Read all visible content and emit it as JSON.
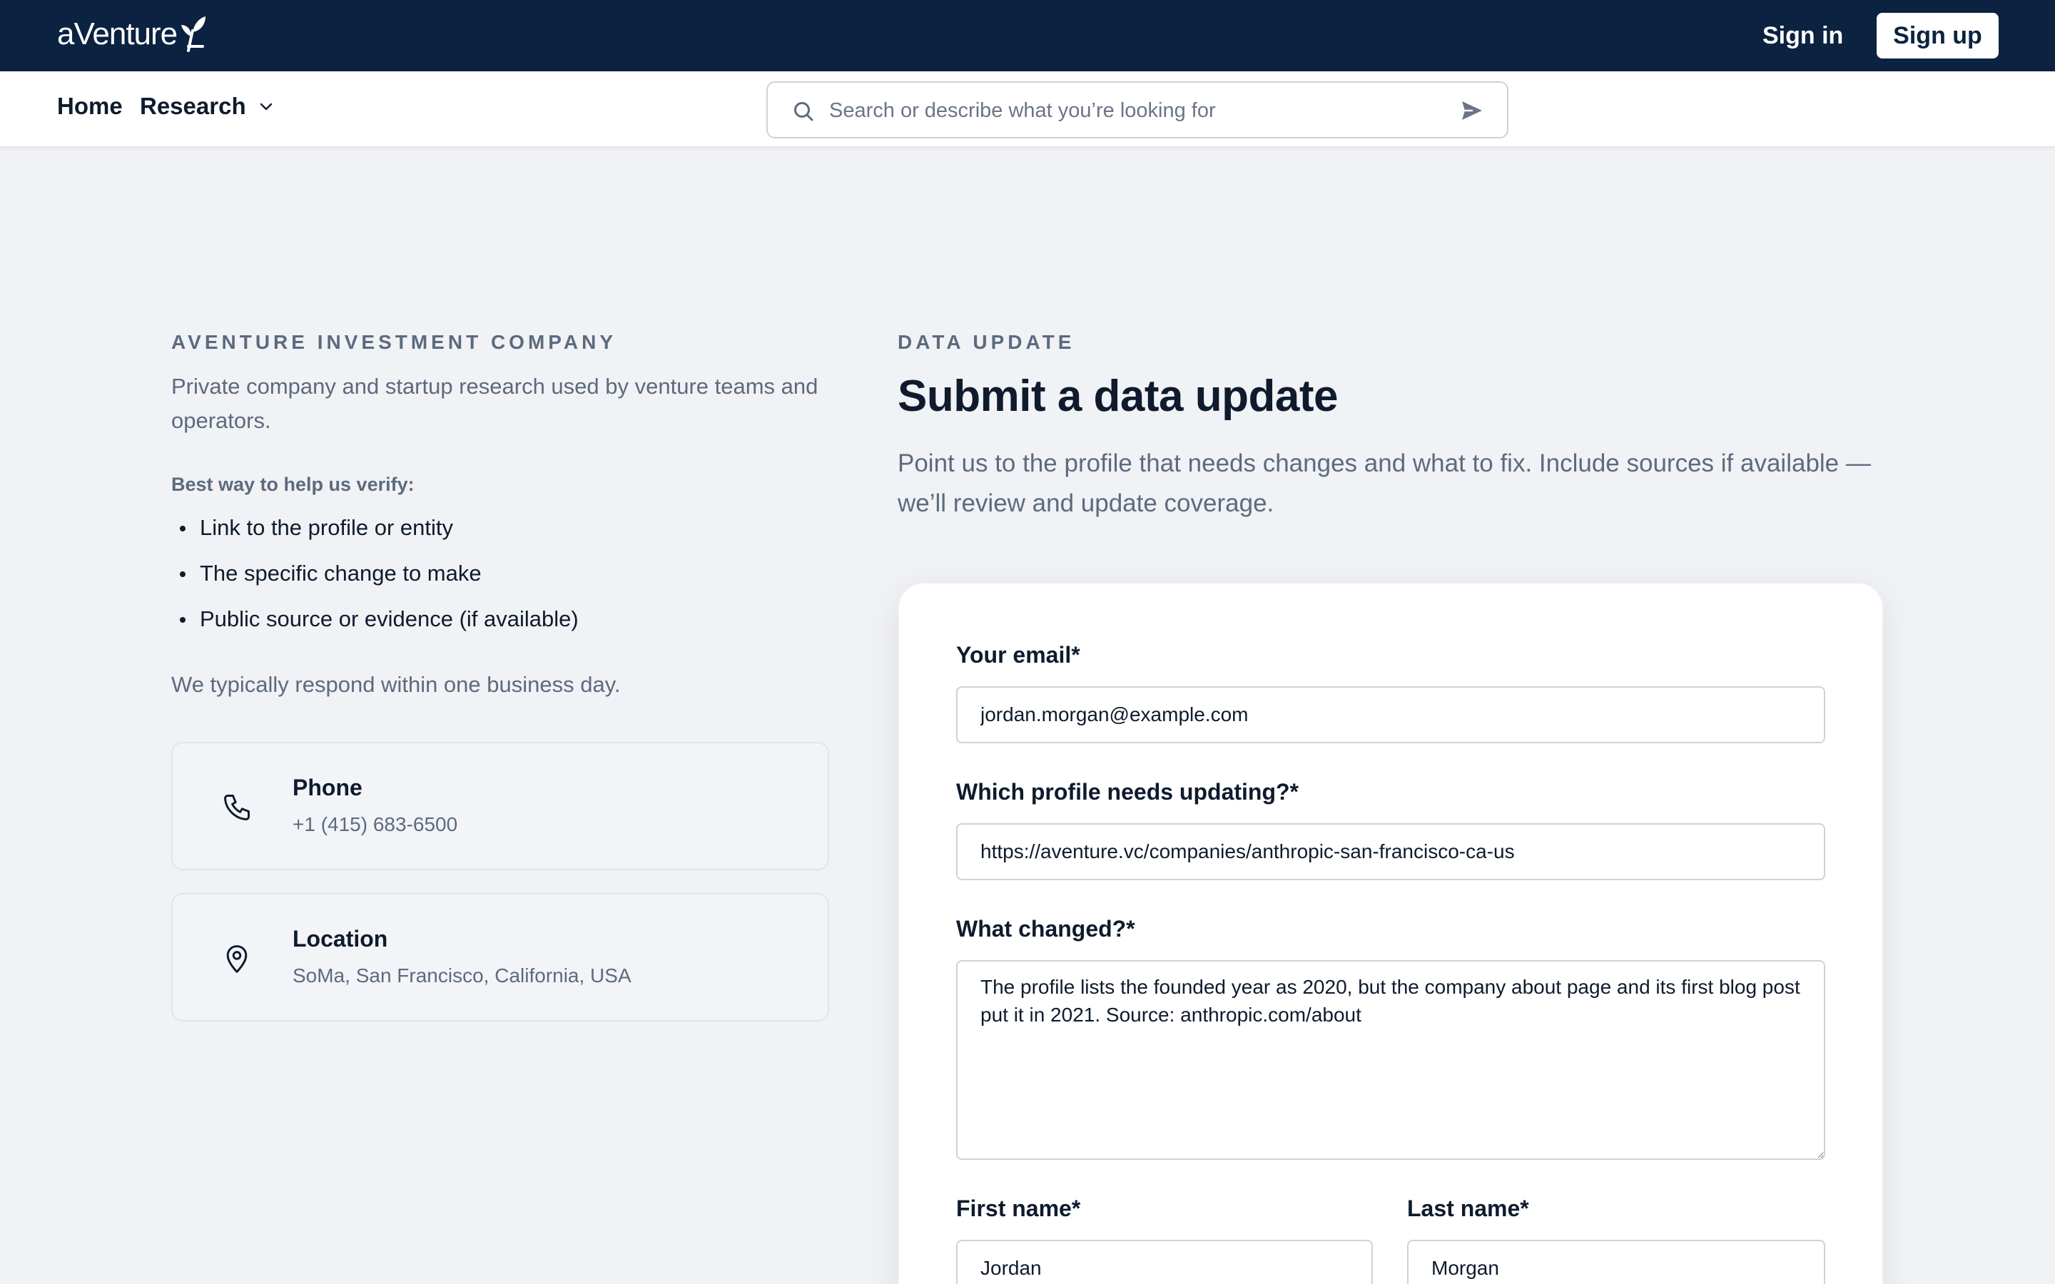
{
  "header": {
    "logo_text": "aVenture",
    "sign_in": "Sign in",
    "sign_up": "Sign up",
    "bg_color": "#0b2240"
  },
  "nav": {
    "home": "Home",
    "research": "Research",
    "search_placeholder": "Search or describe what you’re looking for"
  },
  "company": {
    "eyebrow": "AVENTURE INVESTMENT COMPANY",
    "intro": "Private company and startup research used by venture teams and operators.",
    "verify_label": "Best way to help us verify:",
    "verify_items": [
      "Link to the profile or entity",
      "The specific change to make",
      "Public source or evidence (if available)"
    ],
    "response_note": "We typically respond within one business day.",
    "phone": {
      "title": "Phone",
      "value": "+1 (415) 683-6500",
      "icon": "phone-icon"
    },
    "location": {
      "title": "Location",
      "value": "SoMa, San Francisco, California, USA",
      "icon": "map-pin-icon"
    }
  },
  "form": {
    "eyebrow": "DATA UPDATE",
    "title": "Submit a data update",
    "description": "Point us to the profile that needs changes and what to fix. Include sources if available — we’ll review and update coverage.",
    "email_label": "Your email*",
    "email_value": "jordan.morgan@example.com",
    "profile_label": "Which profile needs updating?*",
    "profile_value": "https://aventure.vc/companies/anthropic-san-francisco-ca-us",
    "changed_label": "What changed?*",
    "changed_value": "The profile lists the founded year as 2020, but the company about page and its first blog post put it in 2021. Source: anthropic.com/about",
    "first_name_label": "First name*",
    "first_name_value": "Jordan",
    "last_name_label": "Last name*",
    "last_name_value": "Morgan"
  }
}
